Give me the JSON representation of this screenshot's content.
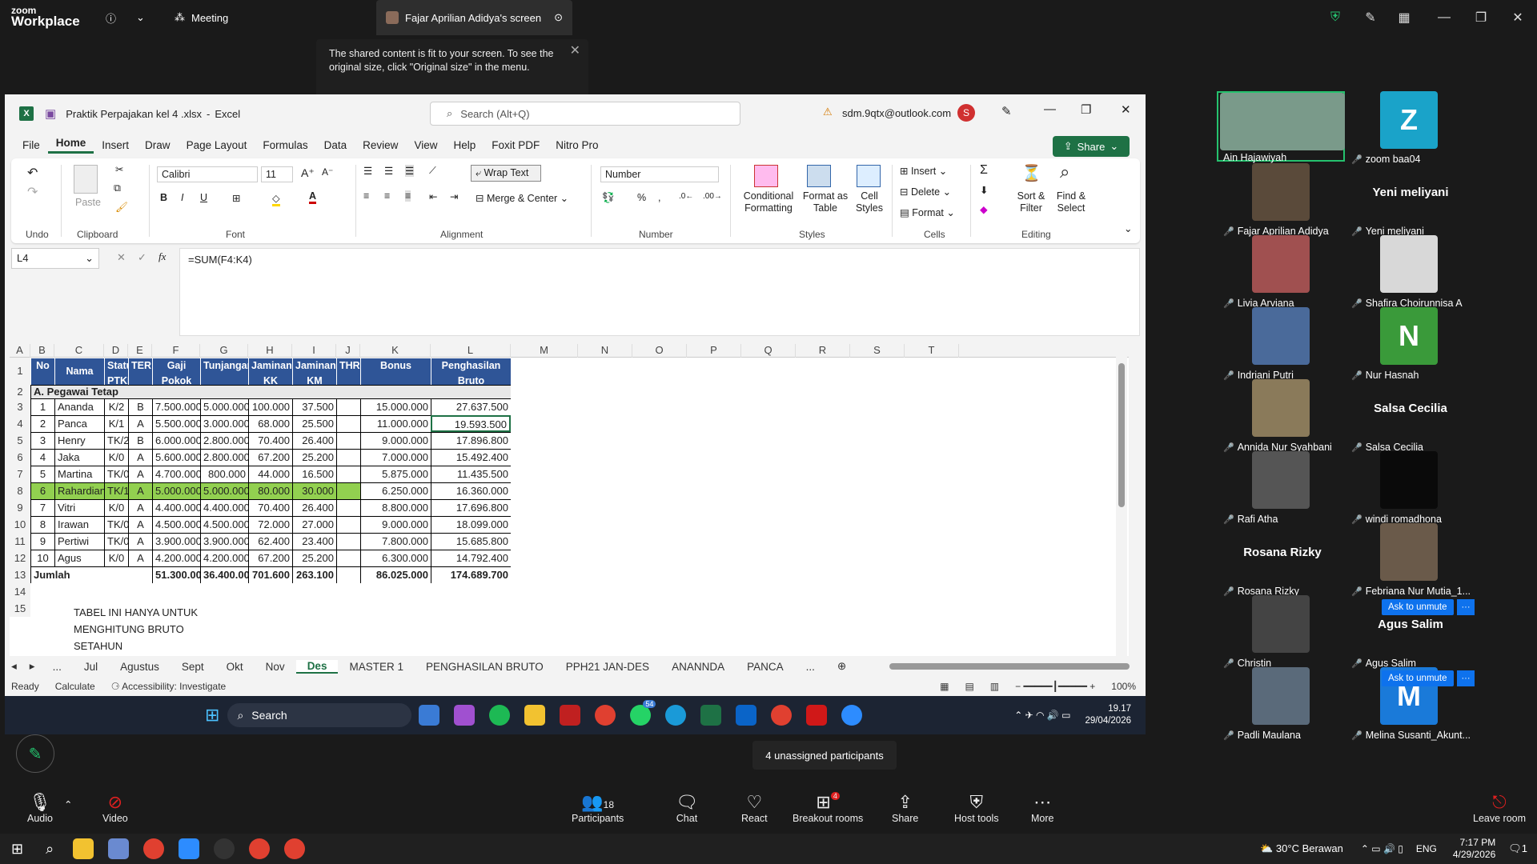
{
  "zoom": {
    "logo_line1": "zoom",
    "logo_line2": "Workplace",
    "meeting_label": "Meeting",
    "screen_tab": "Fajar Aprilian Adidya's screen",
    "notification": "The shared content is fit to your screen. To see the original size, click \"Original size\" in the menu."
  },
  "excel": {
    "filename": "Praktik Perpajakan kel 4 .xlsx",
    "app": "Excel",
    "search_placeholder": "Search (Alt+Q)",
    "account": "sdm.9qtx@outlook.com",
    "account_initial": "S",
    "menu": [
      "File",
      "Home",
      "Insert",
      "Draw",
      "Page Layout",
      "Formulas",
      "Data",
      "Review",
      "View",
      "Help",
      "Foxit PDF",
      "Nitro Pro"
    ],
    "share": "Share",
    "ribbon": {
      "groups": [
        "Undo",
        "Clipboard",
        "Font",
        "Alignment",
        "Number",
        "Styles",
        "Cells",
        "Editing"
      ],
      "paste": "Paste",
      "font_name": "Calibri",
      "font_size": "11",
      "wrap_text": "Wrap Text",
      "merge_center": "Merge & Center",
      "number_format": "Number",
      "conditional": "Conditional Formatting",
      "format_table": "Format as Table",
      "cell_styles": "Cell Styles",
      "insert": "Insert",
      "delete": "Delete",
      "format": "Format",
      "sort_filter": "Sort & Filter",
      "find_select": "Find & Select"
    },
    "name_box": "L4",
    "formula": "=SUM(F4:K4)",
    "columns": [
      "A",
      "B",
      "C",
      "D",
      "E",
      "F",
      "G",
      "H",
      "I",
      "J",
      "K",
      "L",
      "M",
      "N",
      "O",
      "P",
      "Q",
      "R",
      "S",
      "T"
    ],
    "headers": [
      "No",
      "Nama",
      "Status PTKP",
      "TER",
      "Gaji Pokok",
      "Tunjangan",
      "Jaminan KK",
      "Jaminan KM",
      "THR",
      "Bonus",
      "Penghasilan Bruto"
    ],
    "section": "A. Pegawai Tetap",
    "rows": [
      [
        "1",
        "Ananda",
        "K/2",
        "B",
        "7.500.000",
        "5.000.000",
        "100.000",
        "37.500",
        "",
        "15.000.000",
        "27.637.500"
      ],
      [
        "2",
        "Panca",
        "K/1",
        "A",
        "5.500.000",
        "3.000.000",
        "68.000",
        "25.500",
        "",
        "11.000.000",
        "19.593.500"
      ],
      [
        "3",
        "Henry",
        "TK/2",
        "B",
        "6.000.000",
        "2.800.000",
        "70.400",
        "26.400",
        "",
        "9.000.000",
        "17.896.800"
      ],
      [
        "4",
        "Jaka",
        "K/0",
        "A",
        "5.600.000",
        "2.800.000",
        "67.200",
        "25.200",
        "",
        "7.000.000",
        "15.492.400"
      ],
      [
        "5",
        "Martina",
        "TK/0",
        "A",
        "4.700.000",
        "800.000",
        "44.000",
        "16.500",
        "",
        "5.875.000",
        "11.435.500"
      ],
      [
        "6",
        "Rahardian",
        "TK/1",
        "A",
        "5.000.000",
        "5.000.000",
        "80.000",
        "30.000",
        "",
        "6.250.000",
        "16.360.000"
      ],
      [
        "7",
        "Vitri",
        "K/0",
        "A",
        "4.400.000",
        "4.400.000",
        "70.400",
        "26.400",
        "",
        "8.800.000",
        "17.696.800"
      ],
      [
        "8",
        "Irawan",
        "TK/0",
        "A",
        "4.500.000",
        "4.500.000",
        "72.000",
        "27.000",
        "",
        "9.000.000",
        "18.099.000"
      ],
      [
        "9",
        "Pertiwi",
        "TK/0",
        "A",
        "3.900.000",
        "3.900.000",
        "62.400",
        "23.400",
        "",
        "7.800.000",
        "15.685.800"
      ],
      [
        "10",
        "Agus",
        "K/0",
        "A",
        "4.200.000",
        "4.200.000",
        "67.200",
        "25.200",
        "",
        "6.300.000",
        "14.792.400"
      ]
    ],
    "total": [
      "Jumlah",
      "51.300.000",
      "36.400.000",
      "701.600",
      "263.100",
      "86.025.000",
      "174.689.700"
    ],
    "note_lines": [
      "TABEL INI HANYA UNTUK",
      "MENGHITUNG BRUTO",
      "SETAHUN"
    ],
    "row_numbers": [
      "1",
      "2",
      "3",
      "4",
      "5",
      "6",
      "7",
      "8",
      "9",
      "10",
      "11",
      "12",
      "13",
      "14",
      "15"
    ],
    "sheet_tabs": [
      "...",
      "Jul",
      "Agustus",
      "Sept",
      "Okt",
      "Nov",
      "Des",
      "MASTER 1",
      "PENGHASILAN BRUTO",
      "PPH21 JAN-DES",
      "ANANNDA",
      "PANCA",
      "..."
    ],
    "status_ready": "Ready",
    "status_calc": "Calculate",
    "status_access": "Accessibility: Investigate",
    "zoom_level": "100%",
    "inner_search": "Search",
    "inner_time": "19.17",
    "inner_date": "29/04/2026",
    "whatsapp_badge": "54"
  },
  "participants": [
    {
      "name": "Ain Hajawiyah",
      "type": "video",
      "color": "#7a9a8a"
    },
    {
      "name": "zoom baa04",
      "type": "letter",
      "letter": "Z",
      "color": "#1aa3c9"
    },
    {
      "name": "Fajar Aprilian Adidya",
      "type": "video",
      "color": "#5a4a3a"
    },
    {
      "name": "Yeni meliyani",
      "type": "text",
      "big": "Yeni meliyani"
    },
    {
      "name": "Livia Arviana",
      "type": "video",
      "color": "#a05050"
    },
    {
      "name": "Shafira Choirunnisa A",
      "type": "video",
      "color": "#d8d8d8"
    },
    {
      "name": "Indriani Putri",
      "type": "video",
      "color": "#4a6a9a"
    },
    {
      "name": "Nur Hasnah",
      "type": "letter",
      "letter": "N",
      "color": "#3a9a3a"
    },
    {
      "name": "Annida Nur Syahbani",
      "type": "video",
      "color": "#8a7a5a"
    },
    {
      "name": "Salsa Cecilia",
      "type": "text",
      "big": "Salsa Cecilia"
    },
    {
      "name": "Rafi Atha",
      "type": "video",
      "color": "#555"
    },
    {
      "name": "windi romadhona",
      "type": "video",
      "color": "#0a0a0a"
    },
    {
      "name": "Rosana Rizky",
      "type": "text",
      "big": "Rosana Rizky"
    },
    {
      "name": "Febriana Nur Mutia_1...",
      "type": "video",
      "color": "#6a5a4a"
    },
    {
      "name": "Christin",
      "type": "video",
      "color": "#444"
    },
    {
      "name": "Agus Salim",
      "type": "text",
      "big": "Agus Salim"
    },
    {
      "name": "Padli Maulana",
      "type": "video",
      "color": "#5a6a7a"
    },
    {
      "name": "Melina Susanti_Akunt...",
      "type": "letter",
      "letter": "M",
      "color": "#1a7ad9"
    }
  ],
  "ask_unmute": "Ask to unmute",
  "unassigned": "4 unassigned participants",
  "bottom_bar": {
    "audio": "Audio",
    "video": "Video",
    "participants": "Participants",
    "participants_count": "18",
    "chat": "Chat",
    "react": "React",
    "breakout": "Breakout rooms",
    "breakout_badge": "4",
    "share": "Share",
    "host_tools": "Host tools",
    "more": "More",
    "leave": "Leave room"
  },
  "windows": {
    "weather": "30°C Berawan",
    "lang": "ENG",
    "time": "7:17 PM",
    "date": "4/29/2026",
    "notif_count": "1"
  }
}
